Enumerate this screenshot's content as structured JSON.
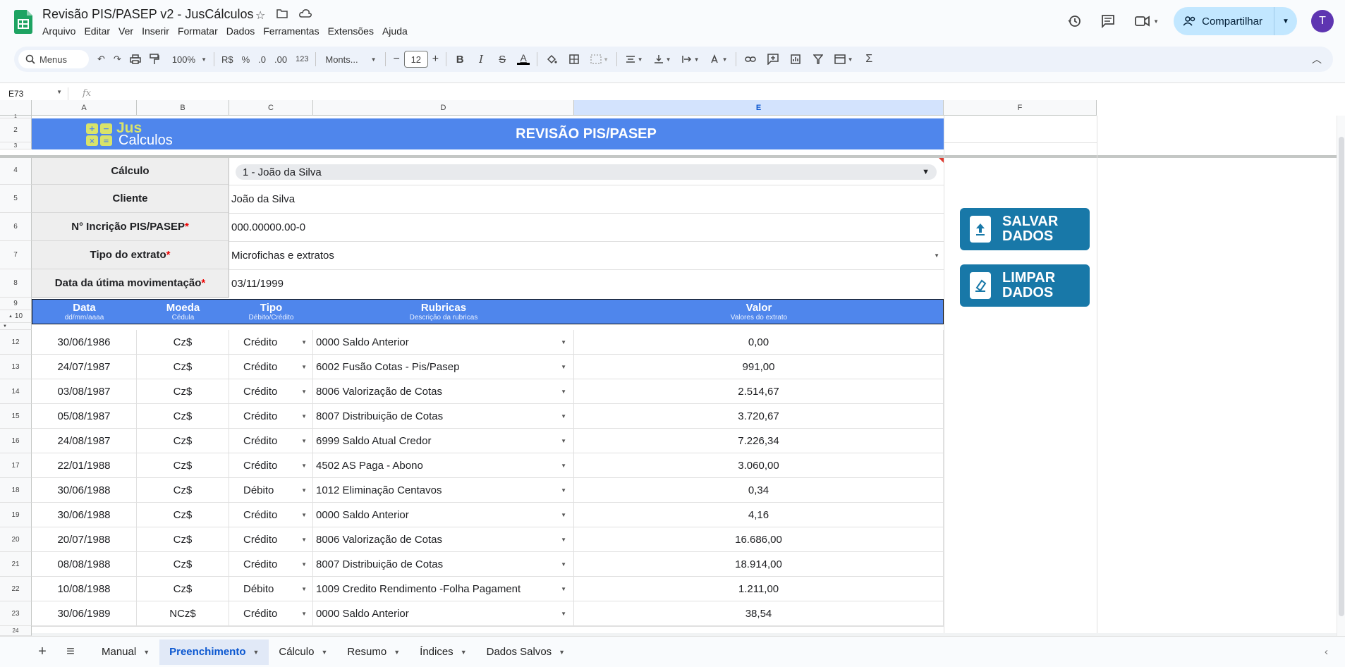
{
  "doc": {
    "title": "Revisão PIS/PASEP v2 - JusCálculos"
  },
  "menu": [
    "Arquivo",
    "Editar",
    "Ver",
    "Inserir",
    "Formatar",
    "Dados",
    "Ferramentas",
    "Extensões",
    "Ajuda"
  ],
  "share": {
    "label": "Compartilhar"
  },
  "avatar": {
    "initial": "T"
  },
  "toolbar": {
    "search": "Menus",
    "zoom": "100%",
    "currency": "R$",
    "percent": "%",
    "dec_minus": ".0",
    "dec_plus": ".00",
    "num_format": "123",
    "font": "Monts...",
    "font_size": "12"
  },
  "formula": {
    "namebox": "E73",
    "fx": "fx",
    "value": ""
  },
  "columns": [
    "A",
    "B",
    "C",
    "D",
    "E",
    "F"
  ],
  "rows": [
    "1",
    "2",
    "3",
    "4",
    "5",
    "6",
    "7",
    "8",
    "9",
    "10",
    "12",
    "13",
    "14",
    "15",
    "16",
    "17",
    "18",
    "19",
    "20",
    "21",
    "22",
    "23",
    "24"
  ],
  "banner": {
    "logo_top": "Jus",
    "logo_bottom": "Calculos",
    "title": "REVISÃO PIS/PASEP"
  },
  "form": {
    "calculo": {
      "label": "Cálculo",
      "value": "1 - João da Silva"
    },
    "cliente": {
      "label": "Cliente",
      "value": "João da Silva"
    },
    "pis": {
      "label": "N° Incrição PIS/PASEP",
      "req": "*",
      "value": "000.00000.00-0"
    },
    "tipo": {
      "label": "Tipo do extrato",
      "req": "*",
      "value": "Microfichas e extratos"
    },
    "data": {
      "label": "Data da útima movimentação",
      "req": "*",
      "value": "03/11/1999"
    }
  },
  "header": {
    "data": {
      "title": "Data",
      "sub": "dd/mm/aaaa"
    },
    "moeda": {
      "title": "Moeda",
      "sub": "Cédula"
    },
    "tipo": {
      "title": "Tipo",
      "sub": "Débito/Crédito"
    },
    "rubricas": {
      "title": "Rubricas",
      "sub": "Descrição da rubricas"
    },
    "valor": {
      "title": "Valor",
      "sub": "Valores do extrato"
    }
  },
  "entries": [
    {
      "data": "30/06/1986",
      "moeda": "Cz$",
      "tipo": "Crédito",
      "rubrica": "0000 Saldo Anterior",
      "valor": "0,00"
    },
    {
      "data": "24/07/1987",
      "moeda": "Cz$",
      "tipo": "Crédito",
      "rubrica": "6002 Fusão Cotas - Pis/Pasep",
      "valor": "991,00"
    },
    {
      "data": "03/08/1987",
      "moeda": "Cz$",
      "tipo": "Crédito",
      "rubrica": "8006 Valorização de Cotas",
      "valor": "2.514,67"
    },
    {
      "data": "05/08/1987",
      "moeda": "Cz$",
      "tipo": "Crédito",
      "rubrica": "8007 Distribuição de Cotas",
      "valor": "3.720,67"
    },
    {
      "data": "24/08/1987",
      "moeda": "Cz$",
      "tipo": "Crédito",
      "rubrica": "6999 Saldo Atual Credor",
      "valor": "7.226,34"
    },
    {
      "data": "22/01/1988",
      "moeda": "Cz$",
      "tipo": "Crédito",
      "rubrica": "4502 AS Paga - Abono",
      "valor": "3.060,00"
    },
    {
      "data": "30/06/1988",
      "moeda": "Cz$",
      "tipo": "Débito",
      "rubrica": "1012 Eliminação Centavos",
      "valor": "0,34"
    },
    {
      "data": "30/06/1988",
      "moeda": "Cz$",
      "tipo": "Crédito",
      "rubrica": "0000 Saldo Anterior",
      "valor": "4,16"
    },
    {
      "data": "20/07/1988",
      "moeda": "Cz$",
      "tipo": "Crédito",
      "rubrica": "8006 Valorização de Cotas",
      "valor": "16.686,00"
    },
    {
      "data": "08/08/1988",
      "moeda": "Cz$",
      "tipo": "Crédito",
      "rubrica": "8007 Distribuição de Cotas",
      "valor": "18.914,00"
    },
    {
      "data": "10/08/1988",
      "moeda": "Cz$",
      "tipo": "Débito",
      "rubrica": "1009 Credito Rendimento -Folha Pagament",
      "valor": "1.211,00"
    },
    {
      "data": "30/06/1989",
      "moeda": "NCz$",
      "tipo": "Crédito",
      "rubrica": "0000 Saldo Anterior",
      "valor": "38,54"
    }
  ],
  "buttons": {
    "salvar": [
      "SALVAR",
      "DADOS"
    ],
    "limpar": [
      "LIMPAR",
      "DADOS"
    ]
  },
  "sheets": [
    {
      "name": "Manual",
      "active": false
    },
    {
      "name": "Preenchimento",
      "active": true
    },
    {
      "name": "Cálculo",
      "active": false
    },
    {
      "name": "Resumo",
      "active": false
    },
    {
      "name": "Índices",
      "active": false
    },
    {
      "name": "Dados Salvos",
      "active": false
    }
  ],
  "colors": {
    "banner": "#4f86ec",
    "button": "#1878a8",
    "share": "#c2e7ff",
    "avatar": "#5e35b1"
  }
}
